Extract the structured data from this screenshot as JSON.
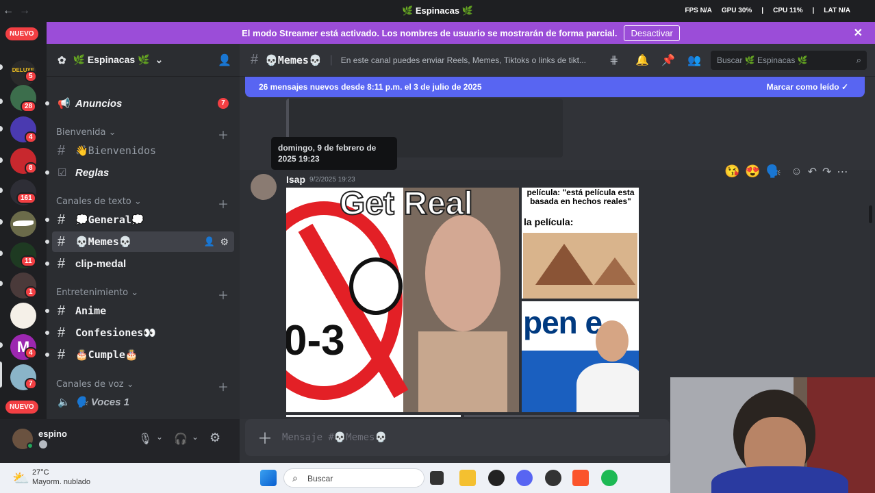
{
  "titlebar": {
    "title": "🌿 Espinacas 🌿",
    "fps_label": "FPS",
    "fps_value": "N/A",
    "gpu_label": "GPU",
    "gpu_value": "30%",
    "cpu_label": "CPU",
    "cpu_value": "11%",
    "lat_label": "LAT",
    "lat_value": "N/A"
  },
  "servers": {
    "nuevo_top": "NUEVO",
    "nuevo_bottom": "NUEVO",
    "badges": [
      "5",
      "28",
      "4",
      "8",
      "161",
      "11",
      "1",
      "4",
      "7"
    ]
  },
  "banner": {
    "text": "El modo Streamer está activado. Los nombres de usuario se mostrarán de forma parcial.",
    "button": "Desactivar"
  },
  "guild": {
    "name": "🌿 Espinacas 🌿"
  },
  "channels": {
    "announcements": {
      "name": "Anuncios",
      "badge": "7"
    },
    "cat_welcome": "Bienvenida",
    "welcome": "👋Bienvenidos",
    "rules": "Reglas",
    "cat_text": "Canales de texto",
    "general": "💭General💭",
    "memes": "💀Memes💀",
    "clip": "clip-medal",
    "cat_fun": "Entretenimiento",
    "anime": "Anime",
    "confesiones": "Confesiones👀",
    "cumple": "🎂Cumple🎂",
    "cat_voice": "Canales de voz",
    "voces": "🗣️ Voces 1"
  },
  "user": {
    "name": "espino"
  },
  "channel_header": {
    "name": "💀Memes💀",
    "topic": "En este canal puedes enviar Reels, Memes, Tiktoks o links de tikt...",
    "search_placeholder": "Buscar 🌿 Espinacas 🌿"
  },
  "new_messages": {
    "text": "26 mensajes nuevos desde 8:11 p.m. el 3 de julio de 2025",
    "action": "Marcar como leído"
  },
  "tooltip": {
    "text": "domingo, 9 de febrero de 2025 19:23"
  },
  "message": {
    "author": "Isap",
    "timestamp": "9/2/2025 19:23",
    "reactions": [
      "😘",
      "😍",
      "🗣️"
    ]
  },
  "memes": {
    "left_caption": "Get Real",
    "sign_text": "0-3",
    "right_top_line1": "película: \"está película esta basada en hechos reales\"",
    "right_top_line2": "la película:",
    "right_bottom_word": "pen e"
  },
  "composer": {
    "placeholder": "Mensaje #💀Memes💀"
  },
  "taskbar": {
    "temp": "27°C",
    "weather": "Mayorm. nublado",
    "search": "Buscar"
  },
  "colors": {
    "blurple": "#5865f2",
    "streamer_banner": "#9b4dd8",
    "red": "#f23f43"
  }
}
